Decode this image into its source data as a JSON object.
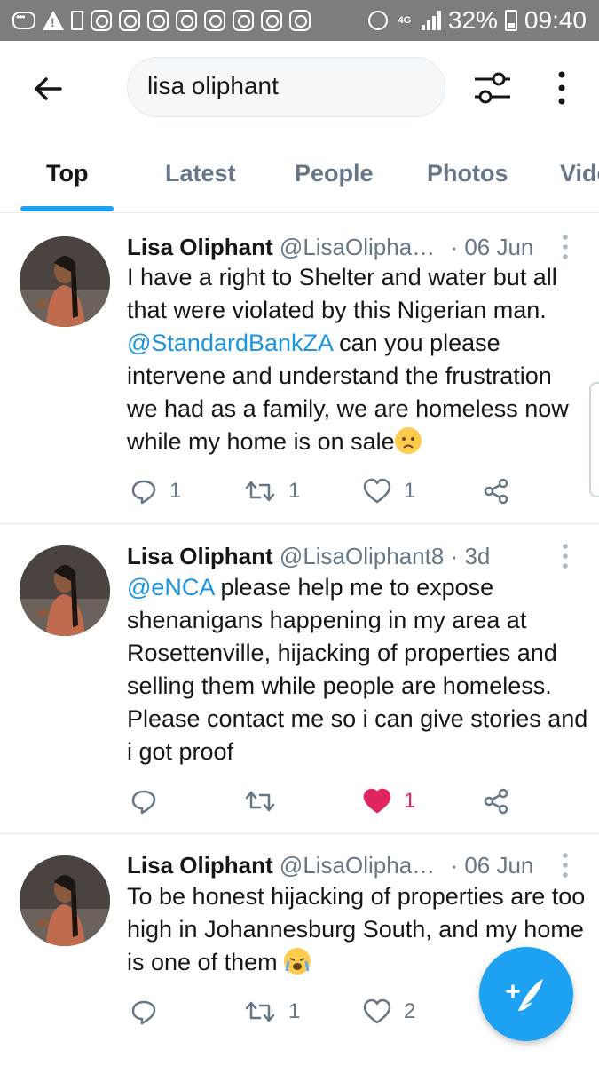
{
  "status_bar": {
    "network": "4G",
    "battery_percent": "32%",
    "time": "09:40"
  },
  "header": {
    "search_value": "lisa oliphant",
    "tabs": [
      "Top",
      "Latest",
      "People",
      "Photos",
      "Vide"
    ],
    "active_tab": "Top"
  },
  "tweets": [
    {
      "name": "Lisa Oliphant",
      "handle": "@LisaOlipha…",
      "separator": "·",
      "time": "06 Jun",
      "text_mention": "@StandardBankZA",
      "text_before": "I have a right to Shelter and water but all that were violated by this Nigerian man.",
      "text_after": "can you please intervene and understand the frustration we had as a family, we are homeless now while my home is on sale",
      "replies": "1",
      "retweets": "1",
      "likes": "1",
      "liked": false
    },
    {
      "name": "Lisa Oliphant",
      "handle": "@LisaOliphant8",
      "separator": "·",
      "time": "3d",
      "text_mention": "@eNCA",
      "text_before": "",
      "text_after": "please help me to expose shenanigans happening in my area at Rosettenville, hijacking of properties and selling them while people are homeless. Please contact me so i can give stories and i got proof",
      "replies": "",
      "retweets": "",
      "likes": "1",
      "liked": true
    },
    {
      "name": "Lisa Oliphant",
      "handle": "@LisaOlipha…",
      "separator": "·",
      "time": "06 Jun",
      "text_mention": "",
      "text_before": "To be honest hijacking of properties are too high in Johannesburg South, and my home is one of them",
      "text_after": "",
      "replies": "",
      "retweets": "1",
      "likes": "2",
      "liked": false
    }
  ],
  "colors": {
    "accent": "#1da1f2",
    "mention": "#1b95e0",
    "like_active": "#e0245e",
    "secondary_text": "#657786",
    "status_bar": "#7d7d7d"
  },
  "icons": [
    "back-arrow-icon",
    "filter-icon",
    "more-vertical-icon",
    "reply-icon",
    "retweet-icon",
    "like-icon",
    "share-icon",
    "compose-icon"
  ]
}
